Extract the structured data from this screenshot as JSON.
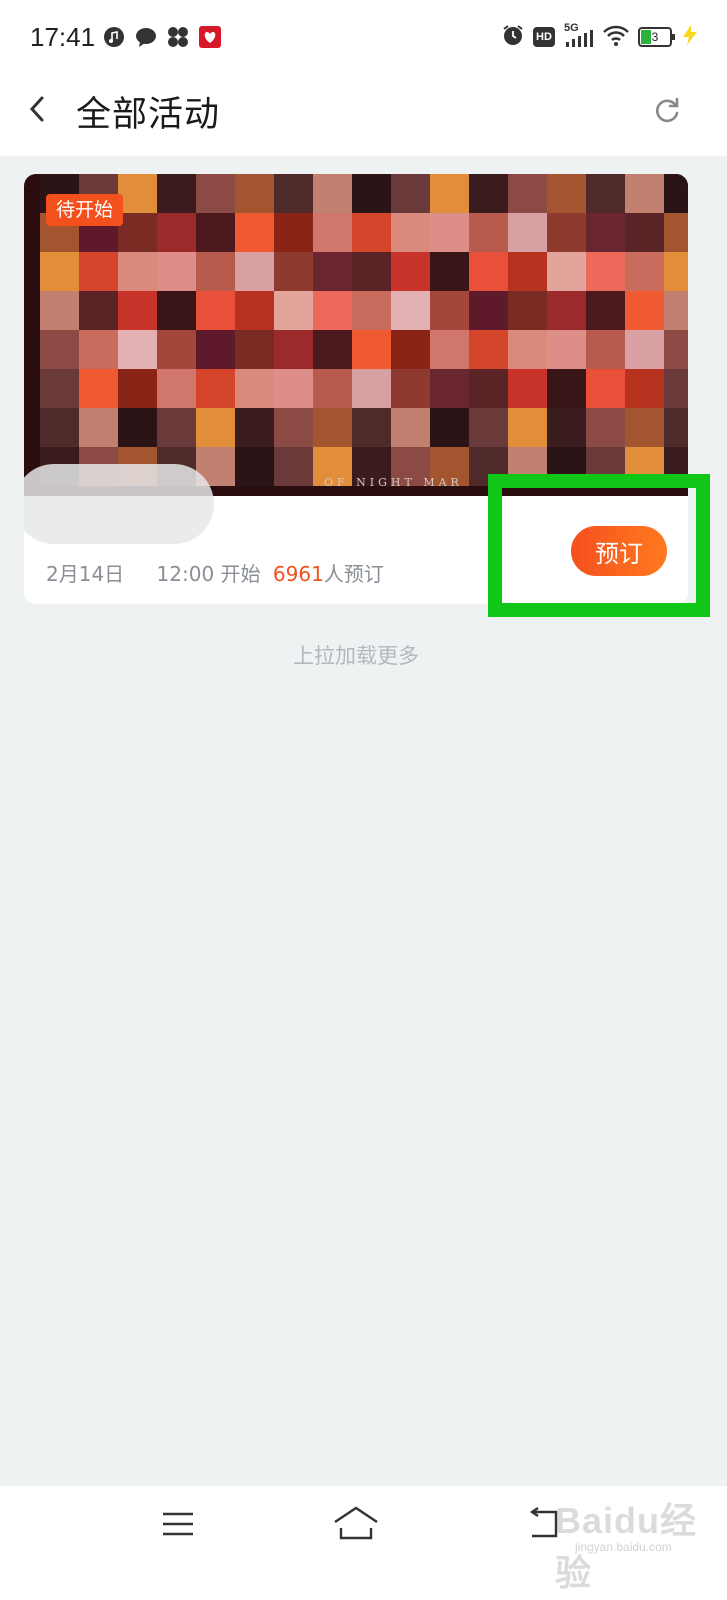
{
  "status_bar": {
    "time": "17:41",
    "hd": "HD",
    "network": "5G",
    "battery_level": "3",
    "notification_icons": [
      "music-icon",
      "chat-bubble-icon",
      "pinwheel-icon",
      "red-app-icon"
    ],
    "system_icons": [
      "alarm-icon",
      "hd-icon",
      "signal-5g-icon",
      "wifi-icon",
      "battery-icon",
      "charging-bolt-icon"
    ]
  },
  "header": {
    "title": "全部活动",
    "back_icon": "chevron-left-icon",
    "refresh_icon": "refresh-icon"
  },
  "event_card": {
    "badge": "待开始",
    "banner_caption": "OF NIGHT MAR",
    "date": "2月14日",
    "start": "12:00 开始",
    "count": "6961",
    "count_suffix": "人预订",
    "book_button": "预订"
  },
  "feed": {
    "load_more": "上拉加载更多"
  },
  "bottom_nav": {
    "icons": [
      "menu-icon",
      "home-icon",
      "back-icon"
    ]
  },
  "watermark": {
    "text": "Baidu经验",
    "sub": "jingyan.baidu.com"
  },
  "colors": {
    "accent": "#f4501e",
    "highlight": "#10c718",
    "background": "#eff2f3"
  }
}
